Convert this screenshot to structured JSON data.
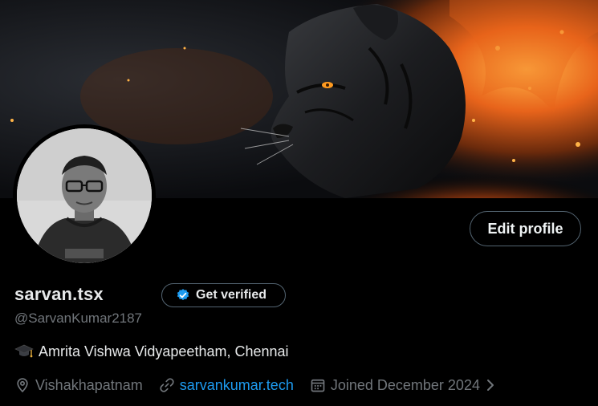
{
  "profile": {
    "display_name": "sarvan.tsx",
    "handle": "@SarvanKumar2187",
    "bio": "Amrita Vishwa Vidyapeetham, Chennai",
    "bio_emoji_icon": "graduation-cap-icon",
    "location": "Vishakhapatnam",
    "website": "sarvankumar.tech",
    "joined": "Joined December 2024"
  },
  "buttons": {
    "edit_profile": "Edit profile",
    "get_verified": "Get verified"
  },
  "colors": {
    "background": "#000000",
    "text_primary": "#e7e9ea",
    "text_secondary": "#71767b",
    "link": "#1d9bf0",
    "verified_badge": "#1d9bf0",
    "button_border": "#536471"
  },
  "icons": {
    "location": "location-pin-icon",
    "website": "link-icon",
    "joined": "calendar-icon",
    "joined_more": "chevron-right-icon",
    "verified": "verified-badge-icon"
  }
}
